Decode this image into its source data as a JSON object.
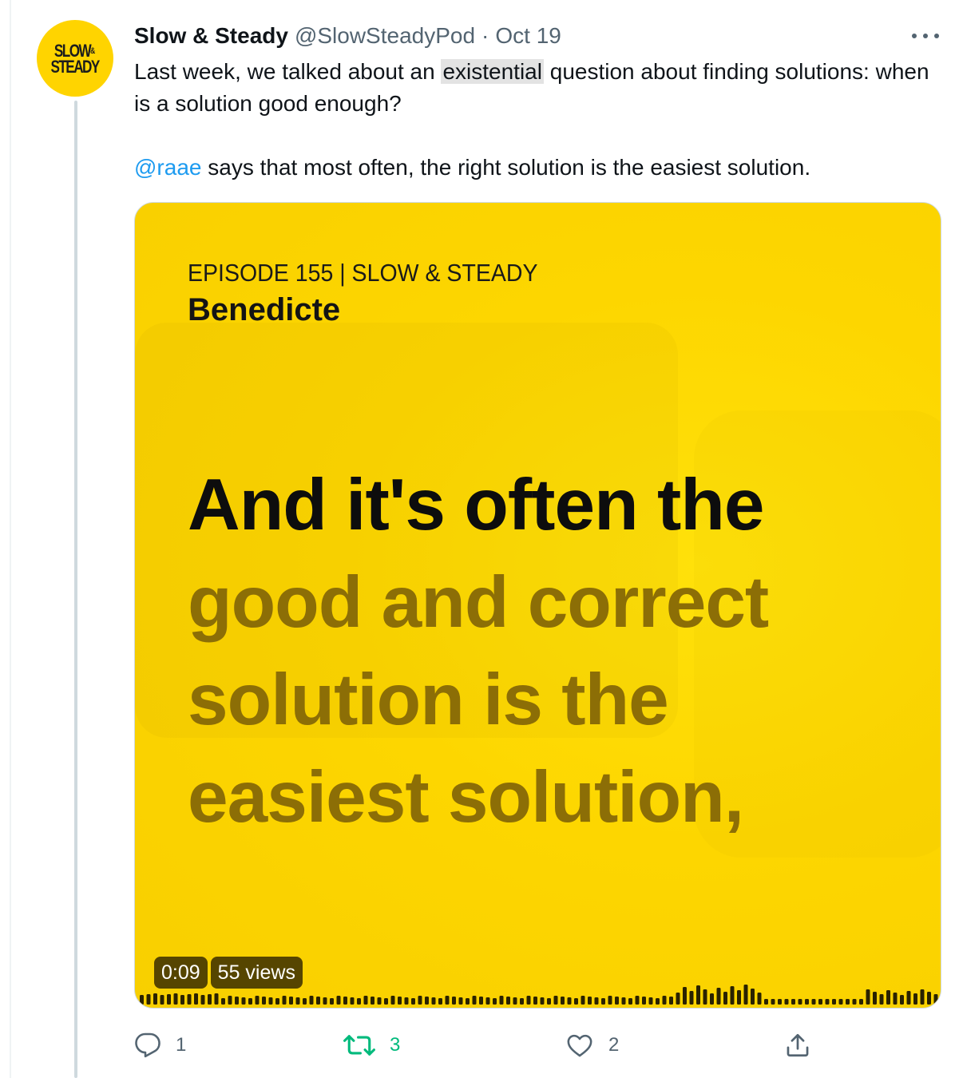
{
  "tweet": {
    "author": {
      "display_name": "Slow & Steady",
      "handle": "@SlowSteadyPod",
      "separator": "·",
      "date": "Oct 19",
      "avatar": {
        "line1": "SLOW",
        "amp": "&",
        "line2": "STEADY"
      }
    },
    "text": {
      "p1_before": "Last week, we talked about an ",
      "p1_highlight": "existential",
      "p1_after": " question about finding solutions: when is a solution good enough?",
      "p2_mention": "@raae",
      "p2_after": " says that most often, the right solution is the easiest solution."
    },
    "media": {
      "episode_title": "EPISODE 155 | SLOW & STEADY",
      "guest": "Benedicte",
      "caption_lines": [
        "And it's often the",
        "good and correct",
        "solution is the",
        "easiest solution,"
      ],
      "timestamp": "0:09",
      "views": "55 views",
      "background_color": "#fdd600"
    },
    "actions": {
      "reply_count": "1",
      "retweet_count": "3",
      "like_count": "2",
      "share_icon": "share-icon"
    }
  },
  "colors": {
    "accent": "#1d9bf0",
    "retweet_green": "#00ba7c",
    "muted": "#536471"
  }
}
